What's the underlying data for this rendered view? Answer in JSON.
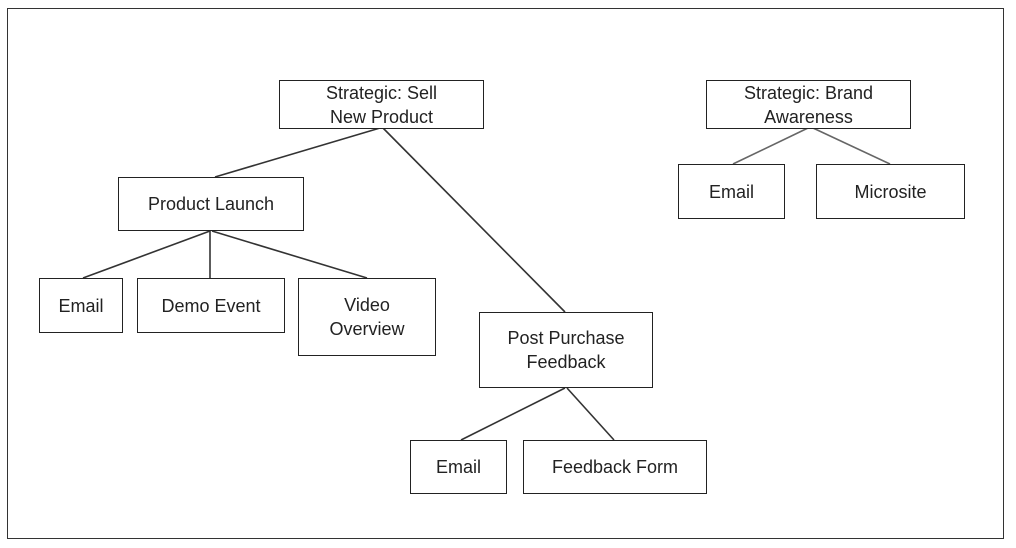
{
  "nodes": {
    "sell": "Strategic: Sell New Product",
    "brand": "Strategic: Brand Awareness",
    "launch": "Product Launch",
    "launch_email": "Email",
    "demo": "Demo Event",
    "video": "Video Overview",
    "ppf": "Post Purchase Feedback",
    "ppf_email": "Email",
    "form": "Feedback Form",
    "brand_email": "Email",
    "microsite": "Microsite"
  },
  "edges": [
    [
      "sell",
      "launch"
    ],
    [
      "sell",
      "ppf"
    ],
    [
      "launch",
      "launch_email"
    ],
    [
      "launch",
      "demo"
    ],
    [
      "launch",
      "video"
    ],
    [
      "ppf",
      "ppf_email"
    ],
    [
      "ppf",
      "form"
    ],
    [
      "brand",
      "brand_email"
    ],
    [
      "brand",
      "microsite"
    ]
  ],
  "colors": {
    "line": "#333333",
    "box_border": "#222222"
  }
}
